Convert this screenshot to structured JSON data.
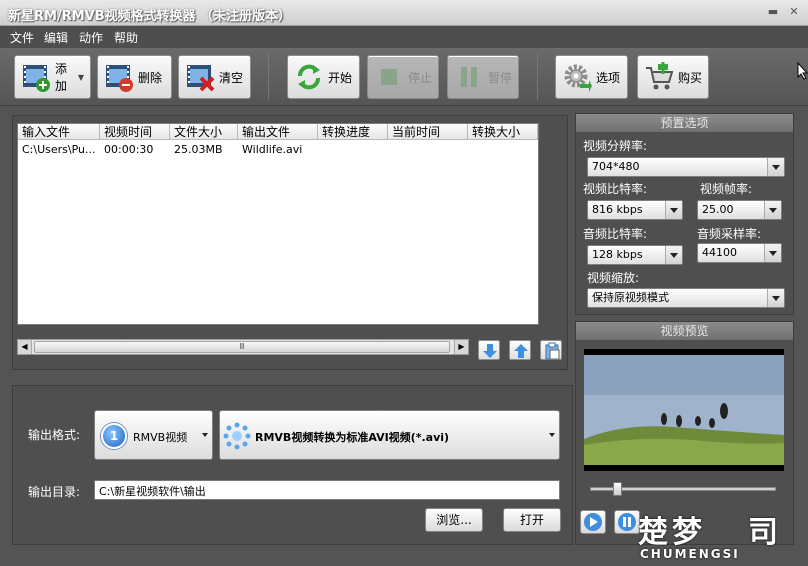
{
  "window": {
    "title": "新星RM/RMVB视频格式转换器 （未注册版本）",
    "min_label": "▬",
    "close_label": "✕"
  },
  "menu": [
    "文件",
    "编辑",
    "动作",
    "帮助"
  ],
  "toolbar": {
    "add": "添加",
    "delete": "删除",
    "clear": "清空",
    "start": "开始",
    "stop": "停止",
    "pause": "暂停",
    "options": "选项",
    "buy": "购买"
  },
  "table": {
    "columns": [
      "输入文件",
      "视频时间",
      "文件大小",
      "输出文件",
      "转换进度",
      "当前时间",
      "转换大小"
    ],
    "rows": [
      [
        "C:\\Users\\Pu...",
        "00:00:30",
        "25.03MB",
        "Wildlife.avi",
        "",
        "",
        ""
      ]
    ]
  },
  "scroll": {
    "grip": "Ⅲ"
  },
  "output": {
    "format_label": "输出格式:",
    "format_value": "RMVB视频",
    "format_icon_text": "1",
    "profile_value": "RMVB视频转换为标准AVI视频(*.avi)",
    "dir_label": "输出目录:",
    "dir_value": "C:\\新星视频软件\\输出",
    "browse": "浏览...",
    "open": "打开"
  },
  "preset": {
    "title": "预置选项",
    "resolution_label": "视频分辨率:",
    "resolution_value": "704*480",
    "vbitrate_label": "视频比特率:",
    "vbitrate_value": "816 kbps",
    "framerate_label": "视频帧率:",
    "framerate_value": "25.00",
    "abitrate_label": "音频比特率:",
    "abitrate_value": "128 kbps",
    "samplerate_label": "音频采样率:",
    "samplerate_value": "44100",
    "scale_label": "视频缩放:",
    "scale_value": "保持原视频模式"
  },
  "preview": {
    "title": "视频预览"
  },
  "watermark": {
    "cn": "楚梦",
    "en": "CHUMENGSI",
    "suffix": "司"
  },
  "colors": {
    "accent_blue": "#2f7fd8",
    "panel": "#4f4f4f"
  }
}
